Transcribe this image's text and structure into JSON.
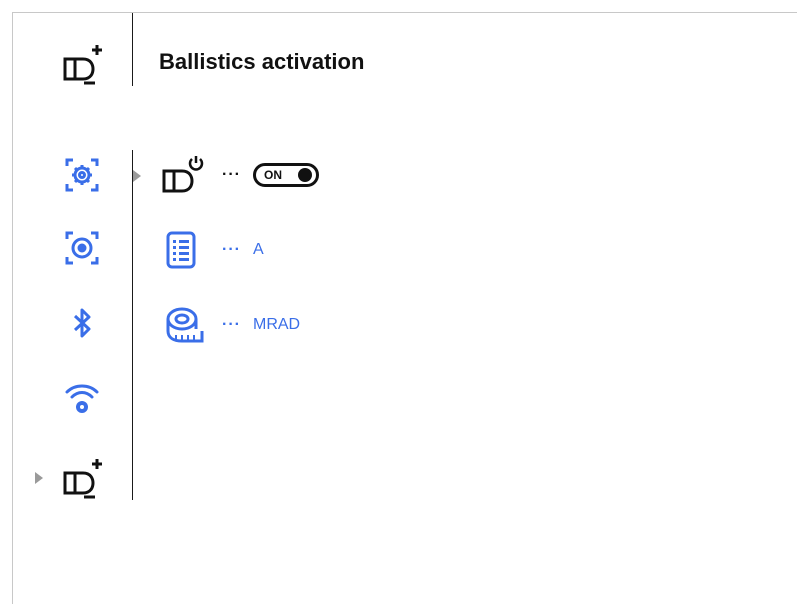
{
  "header": {
    "title": "Ballistics activation",
    "icon": "ballistics-icon"
  },
  "sidebar": {
    "items": [
      {
        "name": "general-settings",
        "icon": "gear-frame-icon",
        "selected": false
      },
      {
        "name": "display-settings",
        "icon": "target-frame-icon",
        "selected": false
      },
      {
        "name": "bluetooth",
        "icon": "bluetooth-icon",
        "selected": false
      },
      {
        "name": "wifi-settings",
        "icon": "wifi-gear-icon",
        "selected": false
      },
      {
        "name": "ballistics",
        "icon": "ballistics-icon",
        "selected": true
      }
    ]
  },
  "rows": [
    {
      "icon": "ballistics-power-icon",
      "dots": "···",
      "toggle_label": "ON",
      "selected": true
    },
    {
      "icon": "profile-list-icon",
      "dots": "···",
      "value": "A"
    },
    {
      "icon": "tape-measure-icon",
      "dots": "···",
      "value": "MRAD"
    }
  ],
  "colors": {
    "accent": "#3a6ee8",
    "text": "#111111",
    "frame": "#c8c8c8",
    "arrow": "#9a9a9a"
  }
}
